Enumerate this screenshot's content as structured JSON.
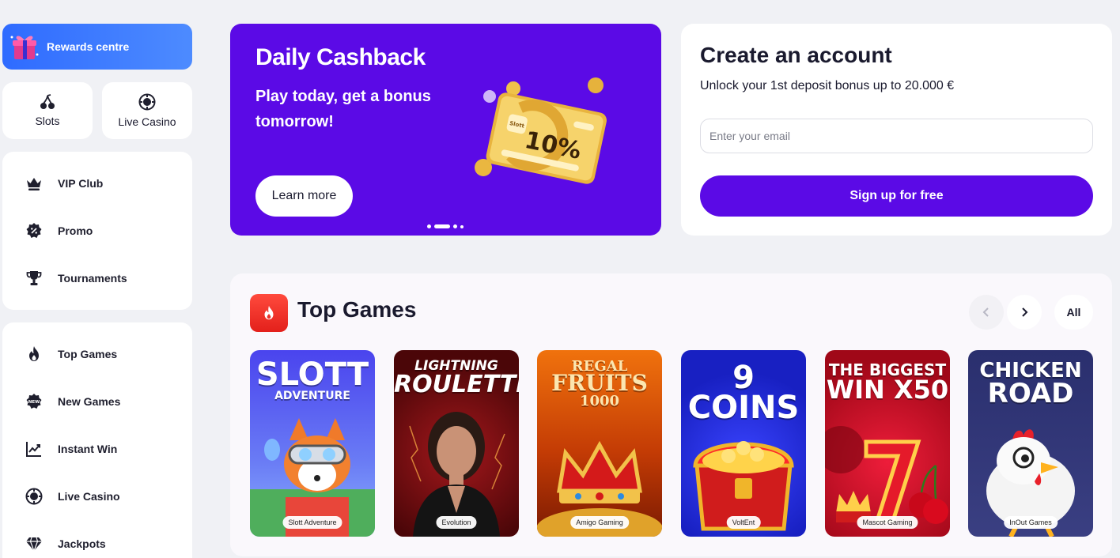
{
  "sidebar": {
    "rewards_label": "Rewards centre",
    "quick": [
      {
        "label": "Slots",
        "icon": "cherries-icon"
      },
      {
        "label": "Live Casino",
        "icon": "chip-icon"
      }
    ],
    "group1": [
      {
        "label": "VIP Club",
        "icon": "crown-icon"
      },
      {
        "label": "Promo",
        "icon": "promo-badge-icon"
      },
      {
        "label": "Tournaments",
        "icon": "trophy-icon"
      }
    ],
    "group2": [
      {
        "label": "Top Games",
        "icon": "fire-icon"
      },
      {
        "label": "New Games",
        "icon": "new-badge-icon"
      },
      {
        "label": "Instant Win",
        "icon": "chart-line-icon"
      },
      {
        "label": "Live Casino",
        "icon": "chip-icon"
      },
      {
        "label": "Jackpots",
        "icon": "diamond-icon"
      }
    ],
    "new_badge_text": "NEW"
  },
  "hero": {
    "title": "Daily Cashback",
    "subtitle": "Play today, get a bonus tomorrow!",
    "button": "Learn more",
    "card_percent": "10%",
    "card_brand": "Slott",
    "slides": 4,
    "active_slide": 2,
    "background": "#5b0ae6"
  },
  "signup": {
    "title": "Create an account",
    "subtitle": "Unlock your 1st deposit bonus up to 20.000 €",
    "email_placeholder": "Enter your email",
    "email_value": "",
    "button": "Sign up for free"
  },
  "top_games": {
    "title": "Top Games",
    "all_label": "All",
    "games": [
      {
        "title_line1": "SLOTT",
        "title_line2": "ADVENTURE",
        "provider": "Slott Adventure",
        "bg": "#3f3ce6"
      },
      {
        "title_line1": "LIGHTNING",
        "title_line2": "ROULETTE",
        "provider": "Evolution",
        "bg": "#7a0d0f"
      },
      {
        "title_line1": "REGAL",
        "title_line2": "FRUITS",
        "title_line3": "1000",
        "provider": "Amigo Gaming",
        "bg": "#d9500b"
      },
      {
        "title_line1": "9 COINS",
        "provider": "VoltEnt",
        "bg": "#1b22d6"
      },
      {
        "title_line1": "THE BIGGEST",
        "title_line2": "WIN X50",
        "provider": "Mascot Gaming",
        "bg": "#d4102b"
      },
      {
        "title_line1": "CHICKEN",
        "title_line2": "ROAD",
        "provider": "InOut Games",
        "bg": "#2b3170"
      }
    ]
  }
}
